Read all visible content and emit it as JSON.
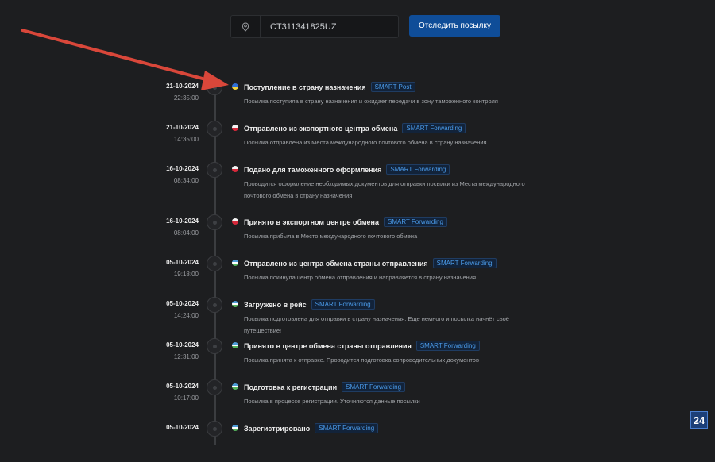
{
  "search": {
    "value": "CT311341825UZ",
    "button_label": "Отследить посылку",
    "pin_icon": "location-pin-icon"
  },
  "events": [
    {
      "date": "21-10-2024",
      "time": "22:35:00",
      "flag": "ua",
      "title": "Поступление в страну назначения",
      "badge": "SMART Post",
      "desc": "Посылка поступила в страну назначения и ожидает передачи в зону таможенного контроля"
    },
    {
      "date": "21-10-2024",
      "time": "14:35:00",
      "flag": "pl",
      "title": "Отправлено из экспортного центра обмена",
      "badge": "SMART Forwarding",
      "desc": "Посылка отправлена из Места международного почтового обмена в страну назначения"
    },
    {
      "date": "16-10-2024",
      "time": "08:34:00",
      "flag": "pl",
      "title": "Подано для таможенного оформления",
      "badge": "SMART Forwarding",
      "desc": "Проводится оформление необходимых документов для отправки посылки из Места международного почтового обмена в страну назначения"
    },
    {
      "date": "16-10-2024",
      "time": "08:04:00",
      "flag": "pl",
      "title": "Принято в экспортном центре обмена",
      "badge": "SMART Forwarding",
      "desc": "Посылка прибыла в Место международного почтового обмена"
    },
    {
      "date": "05-10-2024",
      "time": "19:18:00",
      "flag": "uz",
      "title": "Отправлено из центра обмена страны отправления",
      "badge": "SMART Forwarding",
      "desc": "Посылка покинула центр обмена отправления и направляется в страну назначения"
    },
    {
      "date": "05-10-2024",
      "time": "14:24:00",
      "flag": "uz",
      "title": "Загружено в рейс",
      "badge": "SMART Forwarding",
      "desc": "Посылка подготовлена для отправки в страну назначения. Еще немного и посылка начнёт своё путешествие!"
    },
    {
      "date": "05-10-2024",
      "time": "12:31:00",
      "flag": "uz",
      "title": "Принято в центре обмена страны отправления",
      "badge": "SMART Forwarding",
      "desc": "Посылка принята к отправке. Проводится подготовка сопроводительных документов"
    },
    {
      "date": "05-10-2024",
      "time": "10:17:00",
      "flag": "uz",
      "title": "Подготовка к регистрации",
      "badge": "SMART Forwarding",
      "desc": "Посылка в процессе регистрации. Уточняются данные посылки"
    },
    {
      "date": "05-10-2024",
      "time": "",
      "flag": "uz",
      "title": "Зарегистрировано",
      "badge": "SMART Forwarding",
      "desc": ""
    }
  ],
  "logo": {
    "text": "24"
  },
  "colors": {
    "accent": "#0f4d98",
    "badge_text": "#4a9ae8",
    "arrow": "#d9473a",
    "background": "#1d1e20"
  }
}
